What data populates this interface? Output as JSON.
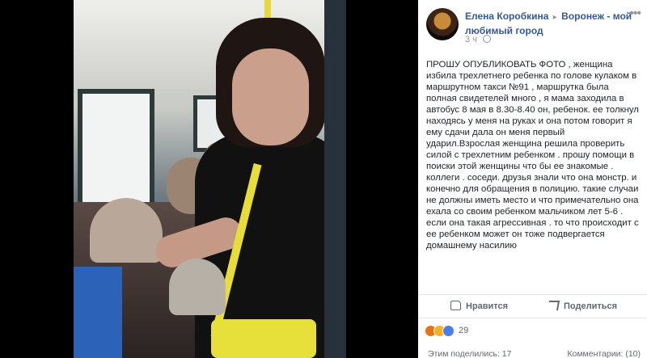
{
  "post": {
    "author": "Елена Коробкина",
    "arrow": "▸",
    "group": "Воронеж - мой любимый город",
    "time": "3 ч",
    "more": "•••",
    "text": "ПРОШУ ОПУБЛИКОВАТЬ ФОТО , женщина избила трехлетнего ребенка по голове кулаком в маршрутном такси №91 , маршрутка была полная свидетелей много , я мама заходила в автобус 8 мая в 8.30-8.40 он, ребенок. ее толкнул находясь у меня на руках и она потом говорит я ему сдачи дала он меня первый ударил.Взрослая женщина решила проверить силой с трехлетним ребенком . прошу помощи в поиски этой женщины что бы ее знакомые . коллеги . соседи. друзья знали что она монстр. и конечно для обращения в полицию. такие случаи не должны иметь место и что примечательно она ехала со своим ребенком мальчиком лет 5-6 . если она такая агрессивная . то что происходит с ее ребенком может он тоже подвергается домашнему насилию"
  },
  "actions": {
    "like": "Нравится",
    "share": "Поделиться"
  },
  "reactions": {
    "count": "29",
    "types": [
      "angry-icon",
      "wow-icon",
      "like-icon"
    ],
    "colors": {
      "angry": "#e9710f",
      "wow": "#f7b125",
      "like": "#4a7fe6"
    }
  },
  "footer": {
    "shared": "Этим поделились: 17",
    "comments": "Комментарии: (10)"
  },
  "colors": {
    "link": "#365899",
    "text": "#1d2129",
    "meta": "#90949c"
  }
}
